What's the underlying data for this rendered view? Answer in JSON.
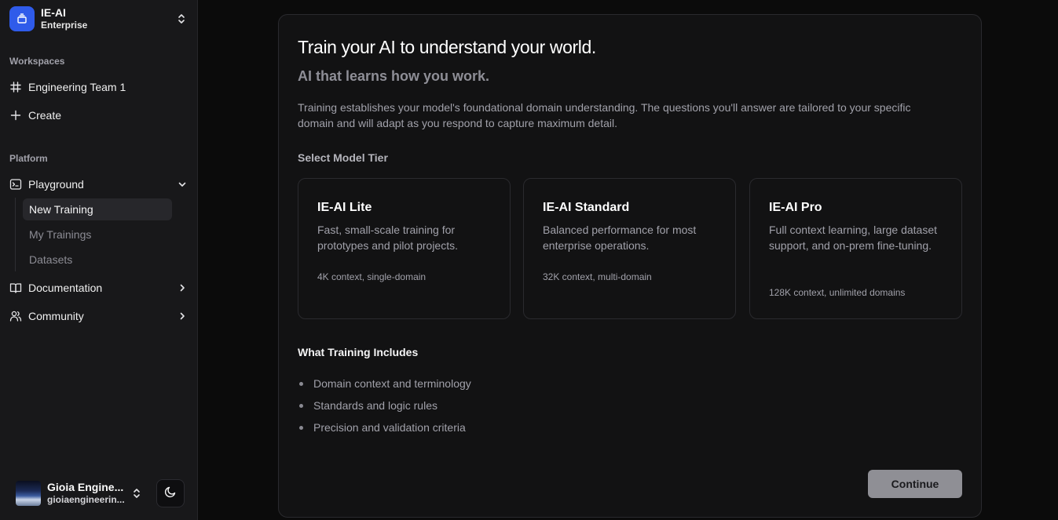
{
  "sidebar": {
    "org": {
      "name": "IE-AI",
      "plan": "Enterprise"
    },
    "workspaces_label": "Workspaces",
    "workspace_items": [
      {
        "label": "Engineering Team 1",
        "icon": "hash-icon"
      },
      {
        "label": "Create",
        "icon": "plus-icon"
      }
    ],
    "platform_label": "Platform",
    "playground": {
      "label": "Playground",
      "icon": "terminal-icon",
      "sub_items": [
        {
          "label": "New Training",
          "active": true
        },
        {
          "label": "My Trainings",
          "active": false
        },
        {
          "label": "Datasets",
          "active": false
        }
      ]
    },
    "documentation": {
      "label": "Documentation",
      "icon": "book-icon"
    },
    "community": {
      "label": "Community",
      "icon": "users-icon"
    },
    "user": {
      "name": "Gioia Engine...",
      "email": "gioiaengineerin..."
    },
    "theme_toggle_icon": "moon-icon"
  },
  "main": {
    "heading": "Train your AI to understand your world.",
    "subheading": "AI that learns how you work.",
    "description": "Training establishes your model's foundational domain understanding. The questions you'll answer are tailored to your specific domain and will adapt as you respond to capture maximum detail.",
    "tier_label": "Select Model Tier",
    "tiers": [
      {
        "name": "IE-AI Lite",
        "description": "Fast, small-scale training for prototypes and pilot projects.",
        "meta": "4K context, single-domain"
      },
      {
        "name": "IE-AI Standard",
        "description": "Balanced performance for most enterprise operations.",
        "meta": "32K context, multi-domain"
      },
      {
        "name": "IE-AI Pro",
        "description": "Full context learning, large dataset support, and on-prem fine-tuning.",
        "meta": "128K context, unlimited domains"
      }
    ],
    "includes_title": "What Training Includes",
    "includes": [
      "Domain context and terminology",
      "Standards and logic rules",
      "Precision and validation criteria"
    ],
    "continue_label": "Continue"
  },
  "colors": {
    "background": "#0b0b0b",
    "sidebar": "#18181a",
    "accent": "#2f5bea",
    "button_disabled": "#8f8f95"
  }
}
